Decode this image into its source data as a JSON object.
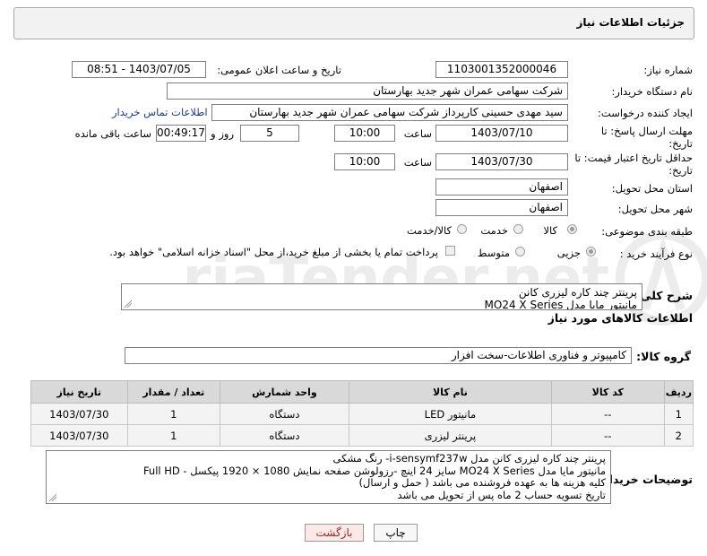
{
  "header": {
    "title": "جزئیات اطلاعات نیاز"
  },
  "fields": {
    "need_number_label": "شماره نیاز:",
    "need_number": "1103001352000046",
    "announce_label": "تاریخ و ساعت اعلان عمومی:",
    "announce_value": "1403/07/05 - 08:51",
    "buyer_org_label": "نام دستگاه خریدار:",
    "buyer_org": "شرکت سهامی عمران شهر جدید بهارستان",
    "creator_label": "ایجاد کننده درخواست:",
    "creator": "سید مهدی حسینی کارپرداز شرکت سهامی عمران شهر جدید بهارستان",
    "contact_link": "اطلاعات تماس خریدار",
    "deadline_label_1": "مهلت ارسال پاسخ: تا",
    "deadline_label_2": "تاریخ:",
    "deadline_date": "1403/07/10",
    "time_label": "ساعت",
    "deadline_time": "10:00",
    "days_value": "5",
    "days_label": "روز و",
    "remaining_value": "00:49:17",
    "remaining_label": "ساعت باقی مانده",
    "validity_label_1": "حداقل تاریخ اعتبار قیمت: تا",
    "validity_label_2": "تاریخ:",
    "validity_date": "1403/07/30",
    "validity_time_label": "ساعت",
    "validity_time": "10:00",
    "province_label": "استان محل تحویل:",
    "province": "اصفهان",
    "city_label": "شهر محل تحویل:",
    "city": "اصفهان",
    "category_label": "طبقه بندی موضوعی:",
    "category_options": [
      "کالا",
      "خدمت",
      "کالا/خدمت"
    ],
    "process_label": "نوع فرآیند خرید :",
    "process_options": [
      "جزیی",
      "متوسط"
    ],
    "payment_note": "پرداخت تمام یا بخشی از مبلغ خرید،از محل \"اسناد خزانه اسلامی\" خواهد بود."
  },
  "summary": {
    "label": "شرح کلی نیاز:",
    "line1": "پرینتر چند کاره لیزری کانن",
    "line2": "مانیتور مایا مدل MO24 X Series"
  },
  "goods": {
    "section_title": "اطلاعات کالاهای مورد نیاز",
    "group_label": "گروه کالا:",
    "group_value": "کامپیوتر و فناوری اطلاعات-سخت افزار"
  },
  "table": {
    "headers": [
      "ردیف",
      "کد کالا",
      "نام کالا",
      "واحد شمارش",
      "تعداد / مقدار",
      "تاریخ نیاز"
    ],
    "rows": [
      [
        "1",
        "--",
        "مانیتور LED",
        "دستگاه",
        "1",
        "1403/07/30"
      ],
      [
        "2",
        "--",
        "پرینتر لیزری",
        "دستگاه",
        "1",
        "1403/07/30"
      ]
    ]
  },
  "buyer_notes": {
    "label": "توضیحات خریدار:",
    "lines": [
      "پرینتر چند کاره لیزری کانن مدل i-sensymf237w- رنگ مشکی",
      "مانیتور مایا مدل MO24 X Series سایز 24 اینچ -رزولوشن صفحه نمایش 1080 × 1920 پیکسل - Full HD",
      "کلیه هزینه ها به عهده فروشنده می باشد ( حمل و ارسال)",
      "تاریخ تسویه حساب 2 ماه پس از تحویل می باشد"
    ]
  },
  "buttons": {
    "print": "چاپ",
    "back": "بازگشت"
  },
  "watermark": {
    "text": "AriaTender.net"
  },
  "colors": {
    "link": "#1a3c8c",
    "back_button_bg": "#fde8e8",
    "print_button_bg": "#f7f7f7"
  },
  "icons": {
    "watermark_logo": "aria-tender-logo-icon"
  }
}
